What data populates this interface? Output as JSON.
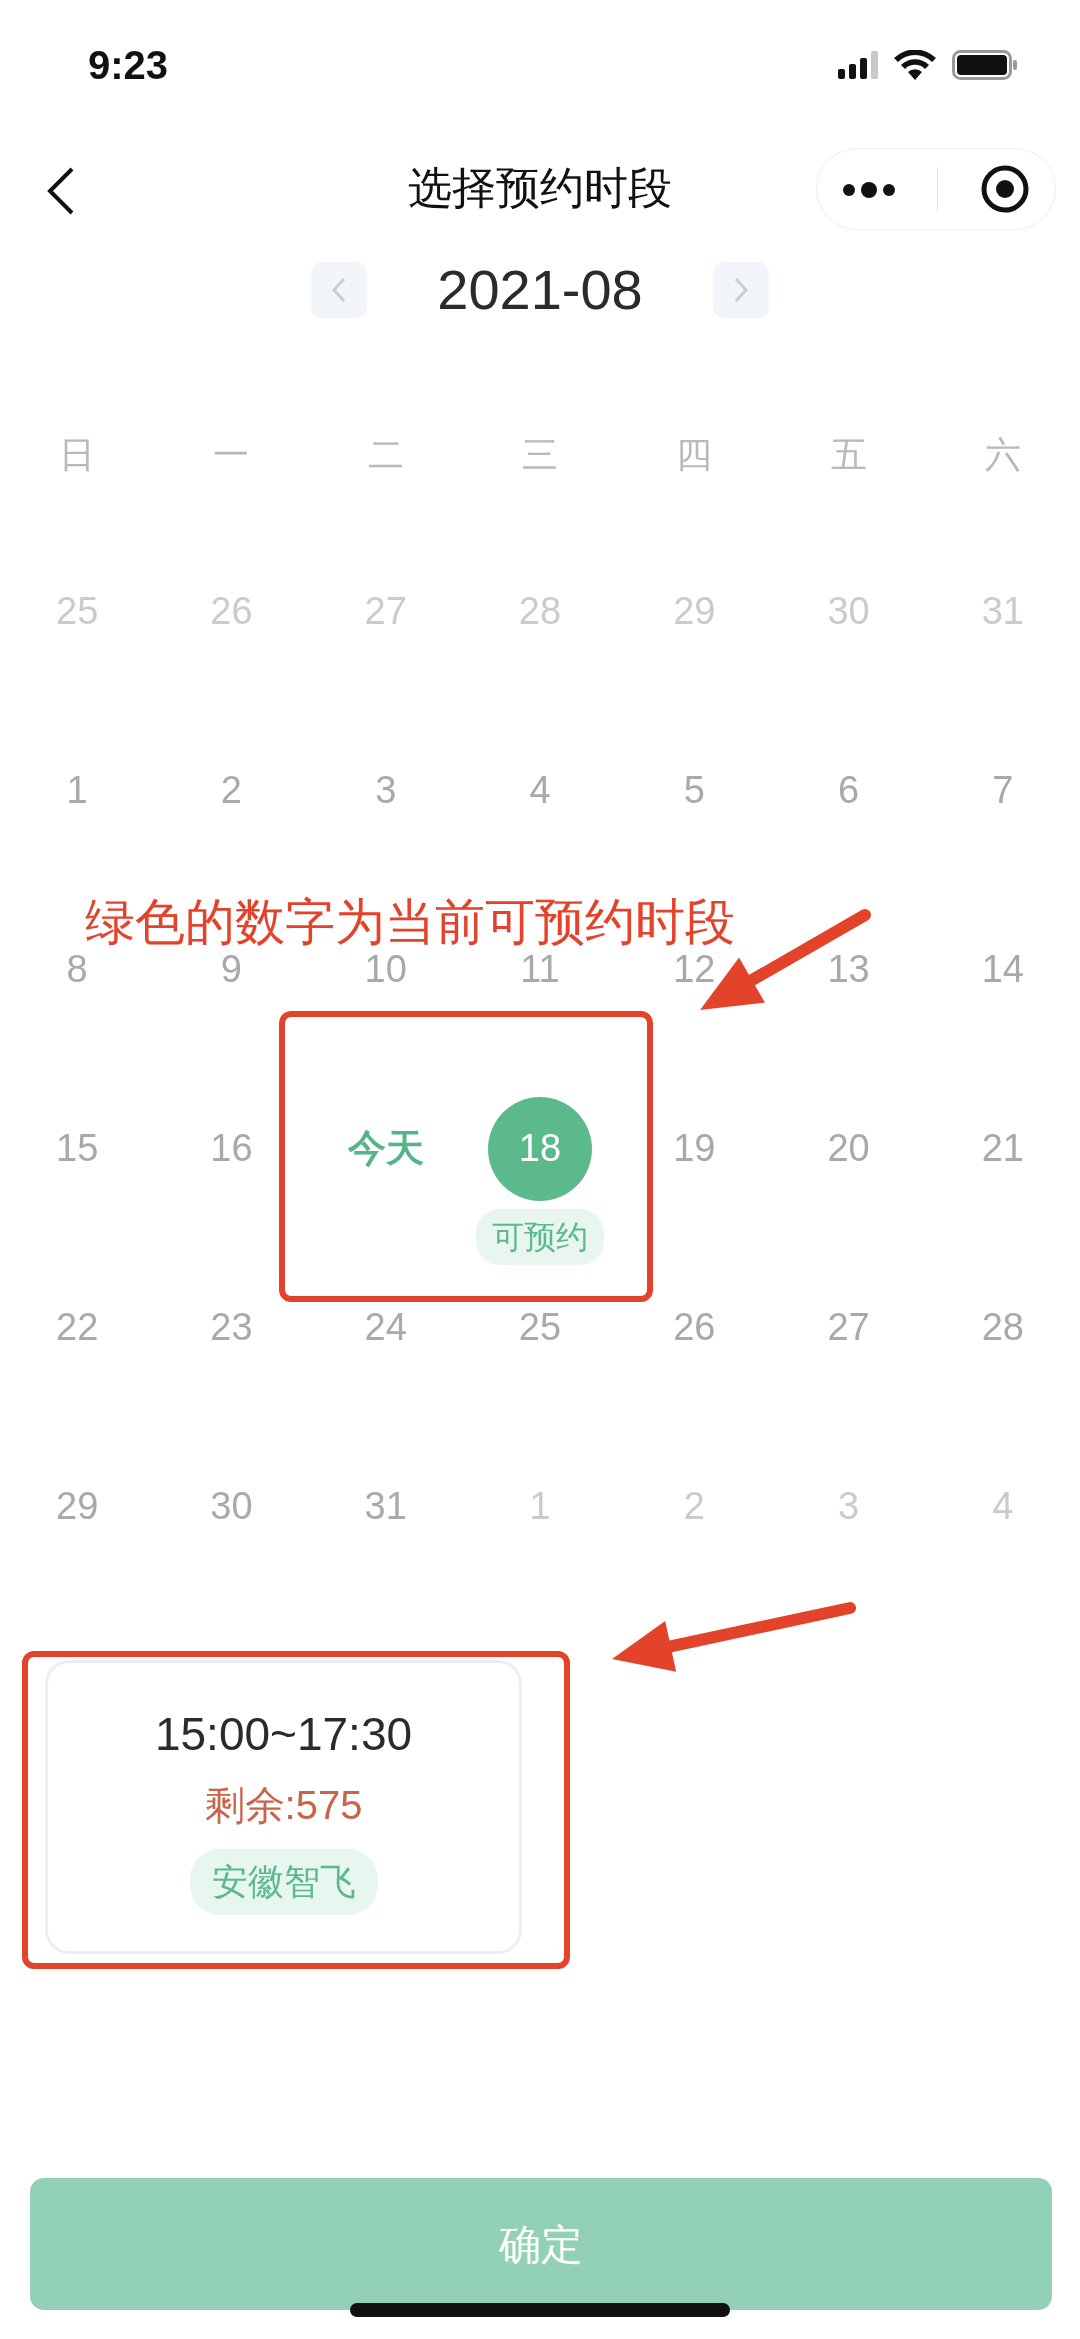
{
  "status_bar": {
    "time": "9:23"
  },
  "nav": {
    "title": "选择预约时段"
  },
  "month": {
    "label": "2021-08"
  },
  "weekdays": [
    "日",
    "一",
    "二",
    "三",
    "四",
    "五",
    "六"
  ],
  "days": [
    {
      "text": "25",
      "kind": "other"
    },
    {
      "text": "26",
      "kind": "other"
    },
    {
      "text": "27",
      "kind": "other"
    },
    {
      "text": "28",
      "kind": "other"
    },
    {
      "text": "29",
      "kind": "other"
    },
    {
      "text": "30",
      "kind": "other"
    },
    {
      "text": "31",
      "kind": "other"
    },
    {
      "text": "1",
      "kind": "day"
    },
    {
      "text": "2",
      "kind": "day"
    },
    {
      "text": "3",
      "kind": "day"
    },
    {
      "text": "4",
      "kind": "day"
    },
    {
      "text": "5",
      "kind": "day"
    },
    {
      "text": "6",
      "kind": "day"
    },
    {
      "text": "7",
      "kind": "day"
    },
    {
      "text": "8",
      "kind": "day"
    },
    {
      "text": "9",
      "kind": "day"
    },
    {
      "text": "10",
      "kind": "day"
    },
    {
      "text": "11",
      "kind": "day"
    },
    {
      "text": "12",
      "kind": "day"
    },
    {
      "text": "13",
      "kind": "day"
    },
    {
      "text": "14",
      "kind": "day"
    },
    {
      "text": "15",
      "kind": "day"
    },
    {
      "text": "16",
      "kind": "day"
    },
    {
      "text": "今天",
      "kind": "today"
    },
    {
      "text": "18",
      "kind": "available",
      "badge": "可预约"
    },
    {
      "text": "19",
      "kind": "day"
    },
    {
      "text": "20",
      "kind": "day"
    },
    {
      "text": "21",
      "kind": "day"
    },
    {
      "text": "22",
      "kind": "day"
    },
    {
      "text": "23",
      "kind": "day"
    },
    {
      "text": "24",
      "kind": "day"
    },
    {
      "text": "25",
      "kind": "day"
    },
    {
      "text": "26",
      "kind": "day"
    },
    {
      "text": "27",
      "kind": "day"
    },
    {
      "text": "28",
      "kind": "day"
    },
    {
      "text": "29",
      "kind": "day"
    },
    {
      "text": "30",
      "kind": "day"
    },
    {
      "text": "31",
      "kind": "day"
    },
    {
      "text": "1",
      "kind": "other"
    },
    {
      "text": "2",
      "kind": "other"
    },
    {
      "text": "3",
      "kind": "other"
    },
    {
      "text": "4",
      "kind": "other"
    }
  ],
  "slots": [
    {
      "time": "15:00~17:30",
      "remaining": "剩余:575",
      "tag": "安徽智飞",
      "selected": false
    }
  ],
  "confirm": {
    "label": "确定",
    "disabled": true
  },
  "annotation": {
    "note": "绿色的数字为当前可预约时段"
  }
}
